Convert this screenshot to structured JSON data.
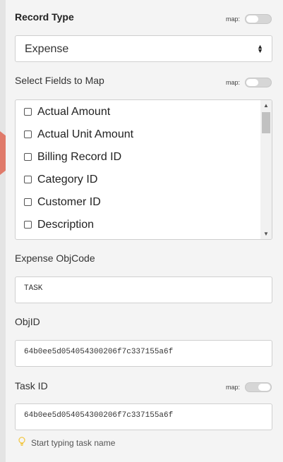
{
  "record_type": {
    "label": "Record Type",
    "map_label": "map:",
    "selected": "Expense",
    "caret_up": "▲",
    "caret_down": "▼"
  },
  "fields": {
    "label": "Select Fields to Map",
    "map_label": "map:",
    "options": [
      "Actual Amount",
      "Actual Unit Amount",
      "Billing Record ID",
      "Category ID",
      "Customer ID",
      "Description"
    ],
    "scroll_up": "▲",
    "scroll_down": "▼"
  },
  "expense_objcode": {
    "label": "Expense ObjCode",
    "value": "TASK"
  },
  "objid": {
    "label": "ObjID",
    "value": "64b0ee5d054054300206f7c337155a6f"
  },
  "task_id": {
    "label": "Task ID",
    "map_label": "map:",
    "value": "64b0ee5d054054300206f7c337155a6f",
    "hint": "Start typing task name"
  },
  "colors": {
    "panel_bg": "#f4f4f4",
    "toggle_bg": "#d6d6d6",
    "hint_icon": "#f2c94c"
  },
  "icons": [
    "lightbulb-icon",
    "checkbox-icon"
  ]
}
